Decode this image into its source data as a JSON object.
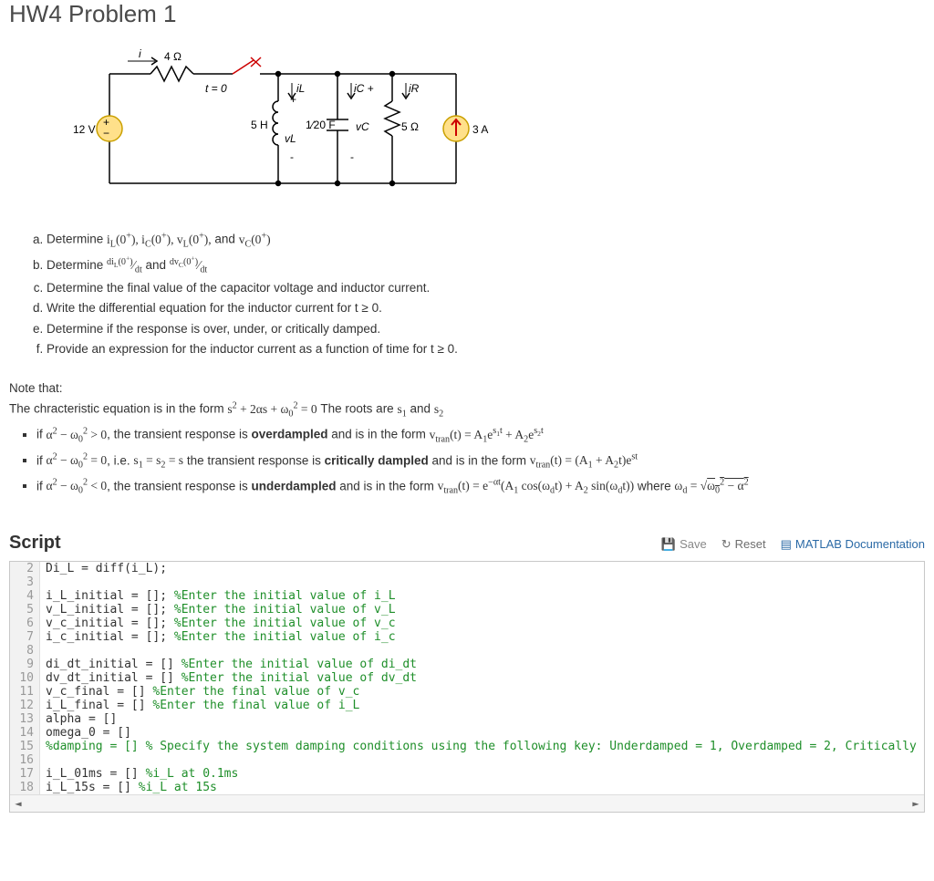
{
  "title": "HW4 Problem 1",
  "circuit": {
    "i": "i",
    "R1": "4 Ω",
    "t0": "t = 0",
    "iL": "iL",
    "ic": "iC +",
    "iR": "iR",
    "Vsrc": "12 V",
    "L": "5 H",
    "vL": "vL",
    "C": "1⁄20 F",
    "vC": "vC",
    "R2": "5 Ω",
    "Isrc": "3 A"
  },
  "questions": {
    "a": "Determine iL(0+), iC(0+), vL(0+), and vC(0+)",
    "b_pre": "Determine ",
    "b_mid": " and ",
    "c": "Determine the final value of the capacitor voltage and inductor current.",
    "d": "Write the differential equation for the inductor current for t ≥ 0.",
    "e": "Determine if the response is over, under, or critically damped.",
    "f": "Provide an expression for the inductor current as a function of time for t ≥ 0."
  },
  "notes": {
    "line1": "Note that:",
    "line2_pre": "The chracteristic equation is in the form ",
    "line2_mid": " The roots are ",
    "bullet1_pre": "if ",
    "bullet1_mid1": ", the transient response is ",
    "bullet1_bold": "overdampled",
    "bullet1_mid2": " and is in the form ",
    "bullet2_pre": "if ",
    "bullet2_mid1": ", i.e. ",
    "bullet2_mid2": "  the transient response is ",
    "bullet2_bold": "critically dampled",
    "bullet2_mid3": " and is in the form ",
    "bullet3_pre": "if ",
    "bullet3_mid1": ", the transient response is ",
    "bullet3_bold": "underdampled",
    "bullet3_mid2": " and is in the form ",
    "bullet3_where": " where "
  },
  "script": {
    "heading": "Script",
    "save": "Save",
    "reset": "Reset",
    "docs": "MATLAB Documentation"
  },
  "code": {
    "lines": [
      {
        "n": 2,
        "segs": [
          {
            "t": "Di_L = diff(i_L);"
          }
        ]
      },
      {
        "n": 3,
        "segs": [
          {
            "t": ""
          }
        ]
      },
      {
        "n": 4,
        "segs": [
          {
            "t": "i_L_initial = []; "
          },
          {
            "t": "%Enter the initial value of i_L",
            "c": "cm"
          }
        ]
      },
      {
        "n": 5,
        "segs": [
          {
            "t": "v_L_initial = []; "
          },
          {
            "t": "%Enter the initial value of v_L",
            "c": "cm"
          }
        ]
      },
      {
        "n": 6,
        "segs": [
          {
            "t": "v_c_initial = []; "
          },
          {
            "t": "%Enter the initial value of v_c",
            "c": "cm"
          }
        ]
      },
      {
        "n": 7,
        "segs": [
          {
            "t": "i_c_initial = []; "
          },
          {
            "t": "%Enter the initial value of i_c",
            "c": "cm"
          }
        ]
      },
      {
        "n": 8,
        "segs": [
          {
            "t": ""
          }
        ]
      },
      {
        "n": 9,
        "segs": [
          {
            "t": "di_dt_initial = [] "
          },
          {
            "t": "%Enter the initial value of di_dt",
            "c": "cm"
          }
        ]
      },
      {
        "n": 10,
        "segs": [
          {
            "t": "dv_dt_initial = [] "
          },
          {
            "t": "%Enter the initial value of dv_dt",
            "c": "cm"
          }
        ]
      },
      {
        "n": 11,
        "segs": [
          {
            "t": "v_c_final = [] "
          },
          {
            "t": "%Enter the final value of v_c",
            "c": "cm"
          }
        ]
      },
      {
        "n": 12,
        "segs": [
          {
            "t": "i_L_final = [] "
          },
          {
            "t": "%Enter the final value of i_L",
            "c": "cm"
          }
        ]
      },
      {
        "n": 13,
        "segs": [
          {
            "t": "alpha = []"
          }
        ]
      },
      {
        "n": 14,
        "segs": [
          {
            "t": "omega_0 = []"
          }
        ]
      },
      {
        "n": 15,
        "segs": [
          {
            "t": "%damping = [] % Specify the system damping conditions using the following key: Underdamped = 1, Overdamped = 2, Critically Damped",
            "c": "cm"
          }
        ]
      },
      {
        "n": 16,
        "segs": [
          {
            "t": ""
          }
        ]
      },
      {
        "n": 17,
        "segs": [
          {
            "t": "i_L_01ms = [] "
          },
          {
            "t": "%i_L at 0.1ms",
            "c": "cm"
          }
        ]
      },
      {
        "n": 18,
        "segs": [
          {
            "t": "i_L_15s = [] "
          },
          {
            "t": "%i_L at 15s",
            "c": "cm"
          }
        ]
      }
    ]
  }
}
